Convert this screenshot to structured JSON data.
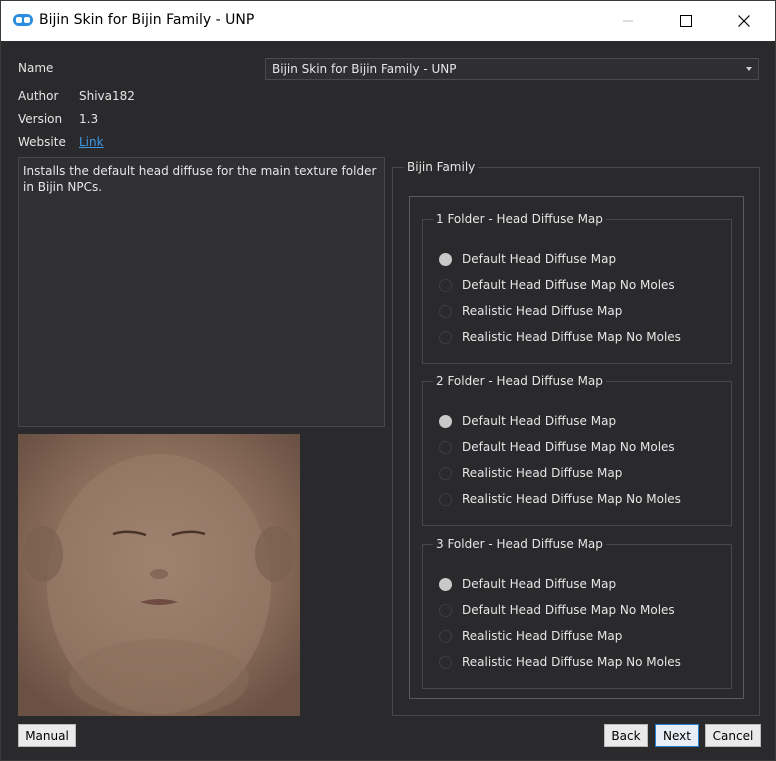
{
  "window": {
    "title": "Bijin Skin for Bijin Family - UNP"
  },
  "info": {
    "name_label": "Name",
    "name_value": "Bijin Skin for Bijin Family - UNP",
    "author_label": "Author",
    "author_value": "Shiva182",
    "version_label": "Version",
    "version_value": "1.3",
    "website_label": "Website",
    "website_link": "Link"
  },
  "description": "Installs the default head diffuse for the main texture folder in Bijin NPCs.",
  "options": {
    "group_title": "Bijin Family",
    "groups": [
      {
        "title": "1 Folder - Head Diffuse Map",
        "items": [
          {
            "label": "Default Head Diffuse Map",
            "checked": true
          },
          {
            "label": "Default Head Diffuse Map No Moles",
            "checked": false
          },
          {
            "label": "Realistic Head Diffuse Map",
            "checked": false
          },
          {
            "label": "Realistic Head Diffuse Map No Moles",
            "checked": false
          }
        ]
      },
      {
        "title": "2 Folder - Head Diffuse Map",
        "items": [
          {
            "label": "Default Head Diffuse Map",
            "checked": true
          },
          {
            "label": "Default Head Diffuse Map No Moles",
            "checked": false
          },
          {
            "label": "Realistic Head Diffuse Map",
            "checked": false
          },
          {
            "label": "Realistic Head Diffuse Map No Moles",
            "checked": false
          }
        ]
      },
      {
        "title": "3 Folder - Head Diffuse Map",
        "items": [
          {
            "label": "Default Head Diffuse Map",
            "checked": true
          },
          {
            "label": "Default Head Diffuse Map No Moles",
            "checked": false
          },
          {
            "label": "Realistic Head Diffuse Map",
            "checked": false
          },
          {
            "label": "Realistic Head Diffuse Map No Moles",
            "checked": false
          }
        ]
      }
    ]
  },
  "buttons": {
    "manual": "Manual",
    "back": "Back",
    "next": "Next",
    "cancel": "Cancel"
  },
  "colors": {
    "background": "#2a2a2d",
    "link": "#3d9ae8",
    "app_icon": "#2b8de0"
  },
  "icons": {
    "app": "app-logo-icon",
    "minimize": "minimize-icon",
    "maximize": "maximize-icon",
    "close": "close-icon"
  }
}
